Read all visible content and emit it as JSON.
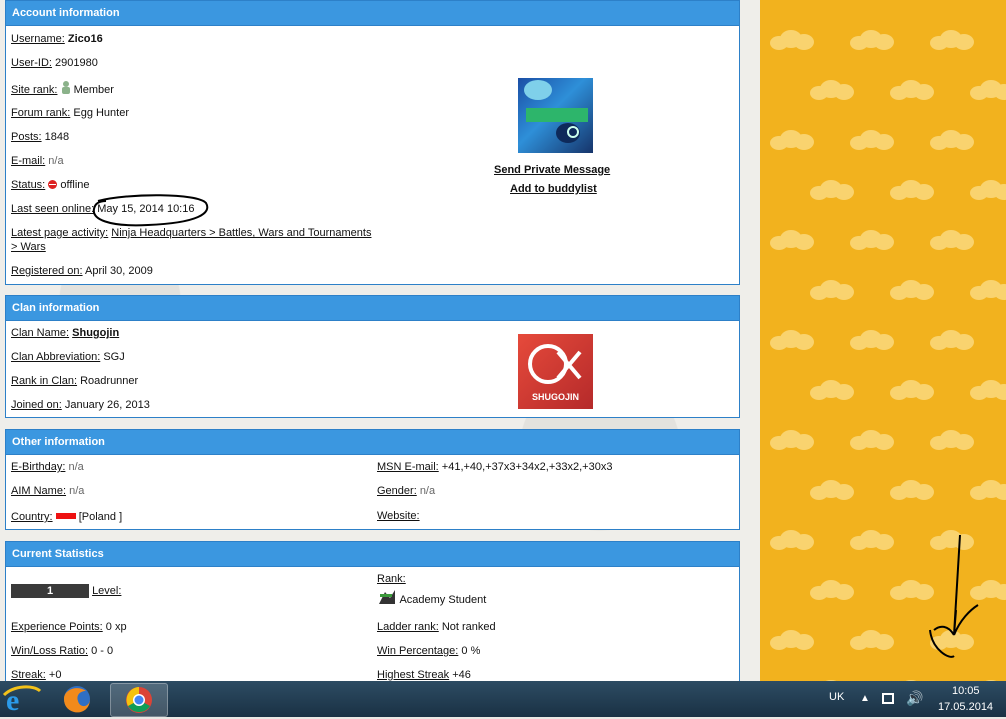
{
  "account": {
    "header": "Account information",
    "username_label": "Username:",
    "username": "Zico16",
    "userid_label": "User-ID:",
    "userid": "2901980",
    "siterank_label": "Site rank:",
    "siterank": "Member",
    "forumrank_label": "Forum rank:",
    "forumrank": "Egg Hunter",
    "posts_label": "Posts:",
    "posts": "1848",
    "email_label": "E-mail:",
    "email": "n/a",
    "status_label": "Status:",
    "status": "offline",
    "lastseen_label": "Last seen online:",
    "lastseen": "May 15, 2014 10:16",
    "activity_label": "Latest page activity:",
    "activity_line1": "Ninja Headquarters > Battles, Wars and Tournaments",
    "activity_line2": "> Wars",
    "registered_label": "Registered on:",
    "registered": "April 30, 2009",
    "send_pm": "Send Private Message",
    "add_buddy": "Add to buddylist"
  },
  "clan": {
    "header": "Clan information",
    "name_label": "Clan Name:",
    "name": "Shugojin",
    "abbr_label": "Clan Abbreviation:",
    "abbr": "SGJ",
    "rank_label": "Rank in Clan:",
    "rank": "Roadrunner",
    "joined_label": "Joined on:",
    "joined": "January 26, 2013",
    "logo_text": "SHUGOJIN"
  },
  "other": {
    "header": "Other information",
    "birthday_label": "E-Birthday:",
    "birthday": "n/a",
    "aim_label": "AIM Name:",
    "aim": "n/a",
    "country_label": "Country:",
    "country": "[Poland ]",
    "msn_label": "MSN E-mail:",
    "msn": "+41,+40,+37x3+34x2,+33x2,+30x3",
    "gender_label": "Gender:",
    "gender": "n/a",
    "website_label": "Website:"
  },
  "stats": {
    "header": "Current Statistics",
    "level_value": "1",
    "level_label": "Level:",
    "rank_label": "Rank:",
    "rank": "Academy Student",
    "xp_label": "Experience Points:",
    "xp": "0 xp",
    "ladder_label": "Ladder rank:",
    "ladder": "Not ranked",
    "winloss_label": "Win/Loss Ratio:",
    "winloss": "0 - 0",
    "winpct_label": "Win Percentage:",
    "winpct": "0 %",
    "streak_label": "Streak:",
    "streak": "+0",
    "highest_label": "Highest Streak",
    "highest": "+46"
  },
  "taskbar": {
    "lang": "UK",
    "time": "10:05",
    "date": "17.05.2014"
  },
  "colors": {
    "header_blue": "#3b97e0",
    "border_blue": "#2d80c8",
    "side_orange": "#f2b21e",
    "cloud": "#f9d36f",
    "status_red": "#d22"
  }
}
